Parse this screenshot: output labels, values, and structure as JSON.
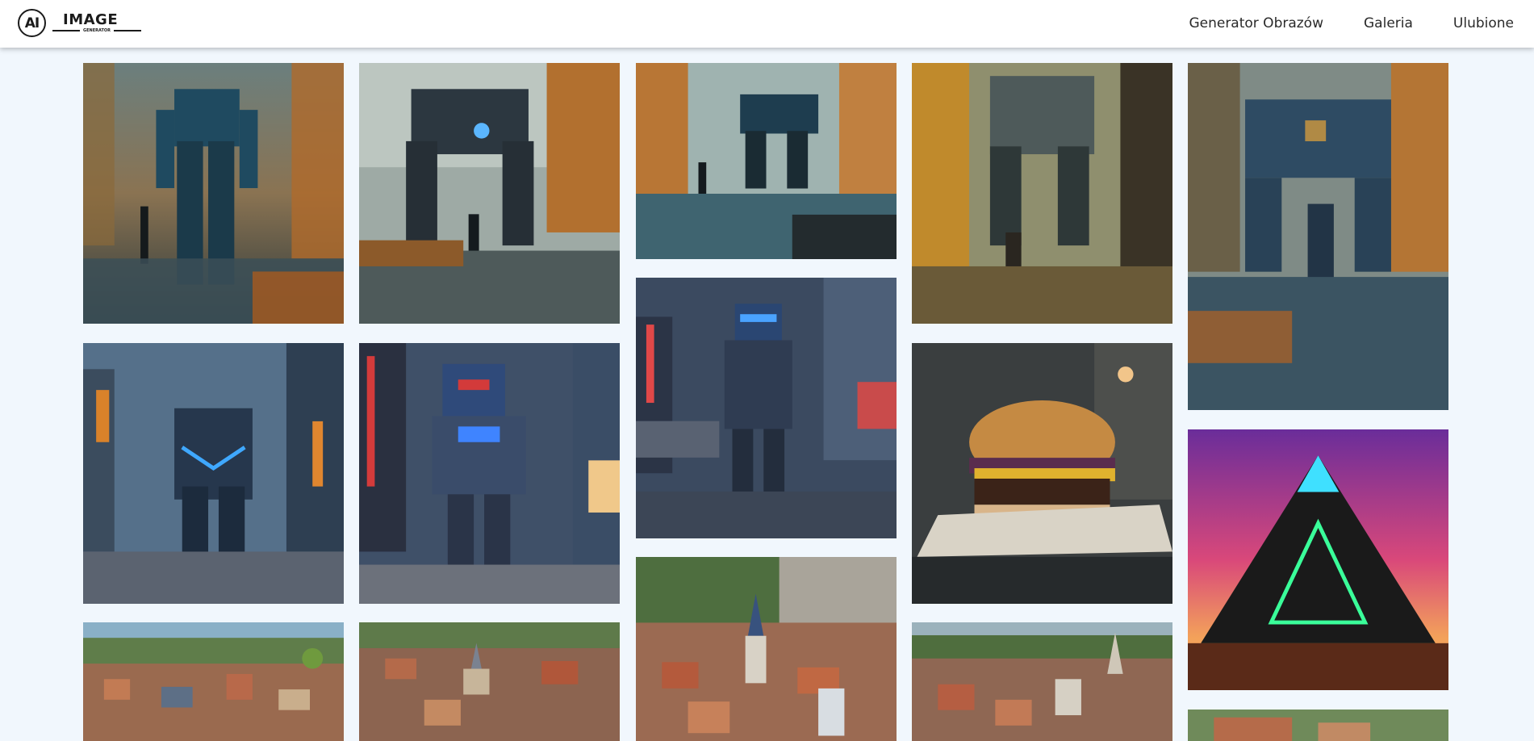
{
  "brand": {
    "logo_mark": "AI",
    "title": "IMAGE",
    "subtitle": "GENERATOR"
  },
  "nav": [
    {
      "label": "Generator Obrazów"
    },
    {
      "label": "Galeria"
    },
    {
      "label": "Ulubione"
    }
  ],
  "gallery": [
    {
      "id": "mech-forest-1",
      "subject": "mech-robot-forest"
    },
    {
      "id": "mech-forest-2",
      "subject": "mech-robot-forest"
    },
    {
      "id": "mech-forest-3",
      "subject": "mech-robot-forest"
    },
    {
      "id": "mech-forest-4",
      "subject": "mech-robot-forest"
    },
    {
      "id": "mech-forest-5",
      "subject": "mech-robot-forest"
    },
    {
      "id": "armor-city-1",
      "subject": "armored-soldier-city"
    },
    {
      "id": "armor-city-2",
      "subject": "armored-soldier-city"
    },
    {
      "id": "armor-city-3",
      "subject": "armored-soldier-city"
    },
    {
      "id": "burger",
      "subject": "burger"
    },
    {
      "id": "pyramid",
      "subject": "neon-pyramid"
    },
    {
      "id": "town-1",
      "subject": "miniature-town"
    },
    {
      "id": "town-2",
      "subject": "miniature-town"
    },
    {
      "id": "town-3",
      "subject": "miniature-town"
    },
    {
      "id": "town-4",
      "subject": "miniature-town"
    },
    {
      "id": "town-5",
      "subject": "miniature-town"
    }
  ],
  "colors": {
    "page_bg": "#f1f7fd",
    "header_bg": "#ffffff",
    "text": "#2a2a2a"
  }
}
